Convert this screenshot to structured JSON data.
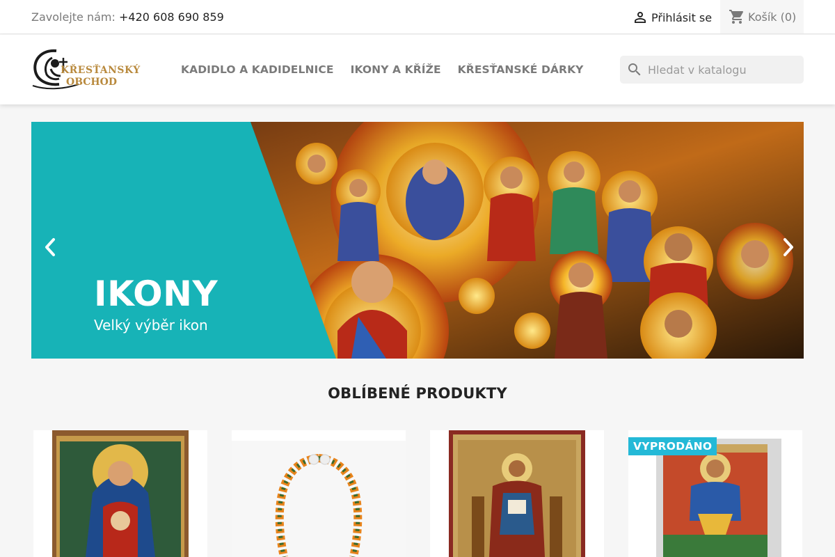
{
  "topbar": {
    "contact_label": "Zavolejte nám:",
    "phone": "+420 608 690 859",
    "login_label": "Přihlásit se",
    "cart_label": "Košík",
    "cart_count": "(0)"
  },
  "header": {
    "logo_line1": "KŘESŤANSKÝ",
    "logo_line2": "OBCHOD",
    "nav": [
      "KADIDLO A KADIDELNICE",
      "IKONY A KŘÍŽE",
      "KŘESŤANSKÉ DÁRKY"
    ],
    "search_placeholder": "Hledat v katalogu"
  },
  "carousel": {
    "title": "IKONY",
    "subtitle": "Velký výběr ikon"
  },
  "featured": {
    "title": "OBLÍBENÉ PRODUKTY",
    "sold_out_flag": "VYPRODÁNO"
  },
  "icons": {
    "user": "person-icon",
    "cart": "shopping-cart-icon",
    "search": "search-icon",
    "prev": "chevron-left-icon",
    "next": "chevron-right-icon"
  },
  "colors": {
    "accent": "#24b9d7",
    "teal_banner": "#17b3b7",
    "logo_gold": "#b98a3e"
  }
}
